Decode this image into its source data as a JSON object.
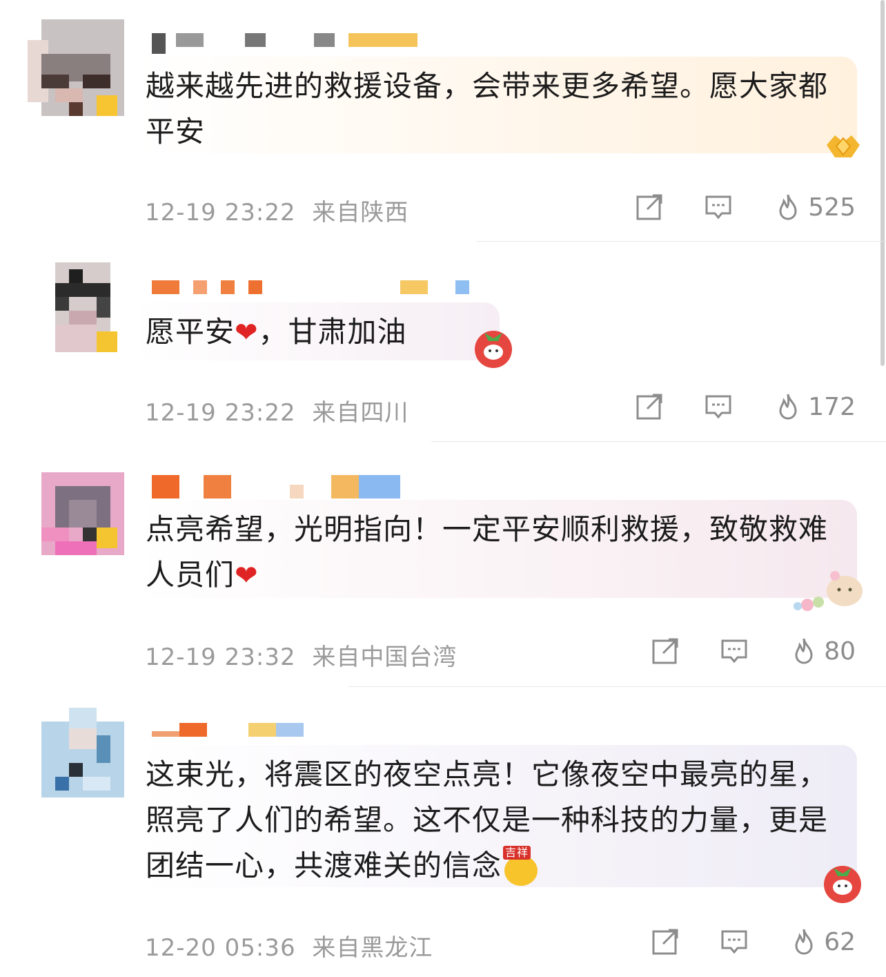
{
  "comments": [
    {
      "text": "越来越先进的救援设备，会带来更多希望。愿大家都平安",
      "time": "12-19 23:22",
      "location": "来自陕西",
      "likes": "525"
    },
    {
      "text": "愿平安",
      "heart": "❤",
      "text_after": "，甘肃加油",
      "time": "12-19 23:22",
      "location": "来自四川",
      "likes": "172"
    },
    {
      "text": "点亮希望，光明指向！一定平安顺利救援，致敬救难人员们",
      "heart": "❤",
      "time": "12-19 23:32",
      "location": "来自中国台湾",
      "likes": "80"
    },
    {
      "text": "这束光，将震区的夜空点亮！它像夜空中最亮的星，照亮了人们的希望。这不仅是一种科技的力量，更是团结一心，共渡难关的信念",
      "emoji_badge": "吉祥",
      "time": "12-20 05:36",
      "location": "来自黑龙江",
      "likes": "62"
    }
  ],
  "colors": {
    "meta": "#9a9a9a",
    "heart": "#e02424",
    "bubble1": "#fff6e8",
    "bubble2": "#f6eef4",
    "bubble3": "#f8eef2",
    "bubble4": "#f2f0f8"
  },
  "icons": [
    "share-icon",
    "comment-icon",
    "fire-like-icon"
  ]
}
